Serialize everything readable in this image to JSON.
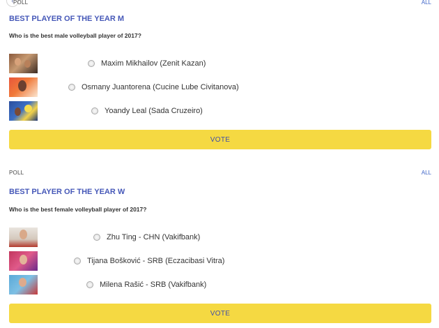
{
  "poll_male": {
    "section_label": "POLL",
    "all_label": "ALL",
    "title": "BEST PLAYER OF THE YEAR M",
    "question": "Who is the best male volleyball player of 2017?",
    "options": [
      {
        "label": "Maxim Mikhailov (Zenit Kazan)"
      },
      {
        "label": "Osmany Juantorena (Cucine Lube Civitanova)"
      },
      {
        "label": "Yoandy Leal (Sada Cruzeiro)"
      }
    ],
    "vote_label": "VOTE"
  },
  "poll_female": {
    "section_label": "POLL",
    "all_label": "ALL",
    "title": "BEST PLAYER OF THE YEAR W",
    "question": "Who is the best female volleyball player of 2017?",
    "options": [
      {
        "label": "Zhu Ting - CHN (Vakifbank)"
      },
      {
        "label": "Tijana Bošković - SRB (Eczacibasi Vitra)"
      },
      {
        "label": "Milena Rašić - SRB (Vakifbank)"
      }
    ],
    "vote_label": "VOTE"
  },
  "colors": {
    "accent_blue": "#4658b8",
    "vote_yellow": "#f5d942"
  }
}
